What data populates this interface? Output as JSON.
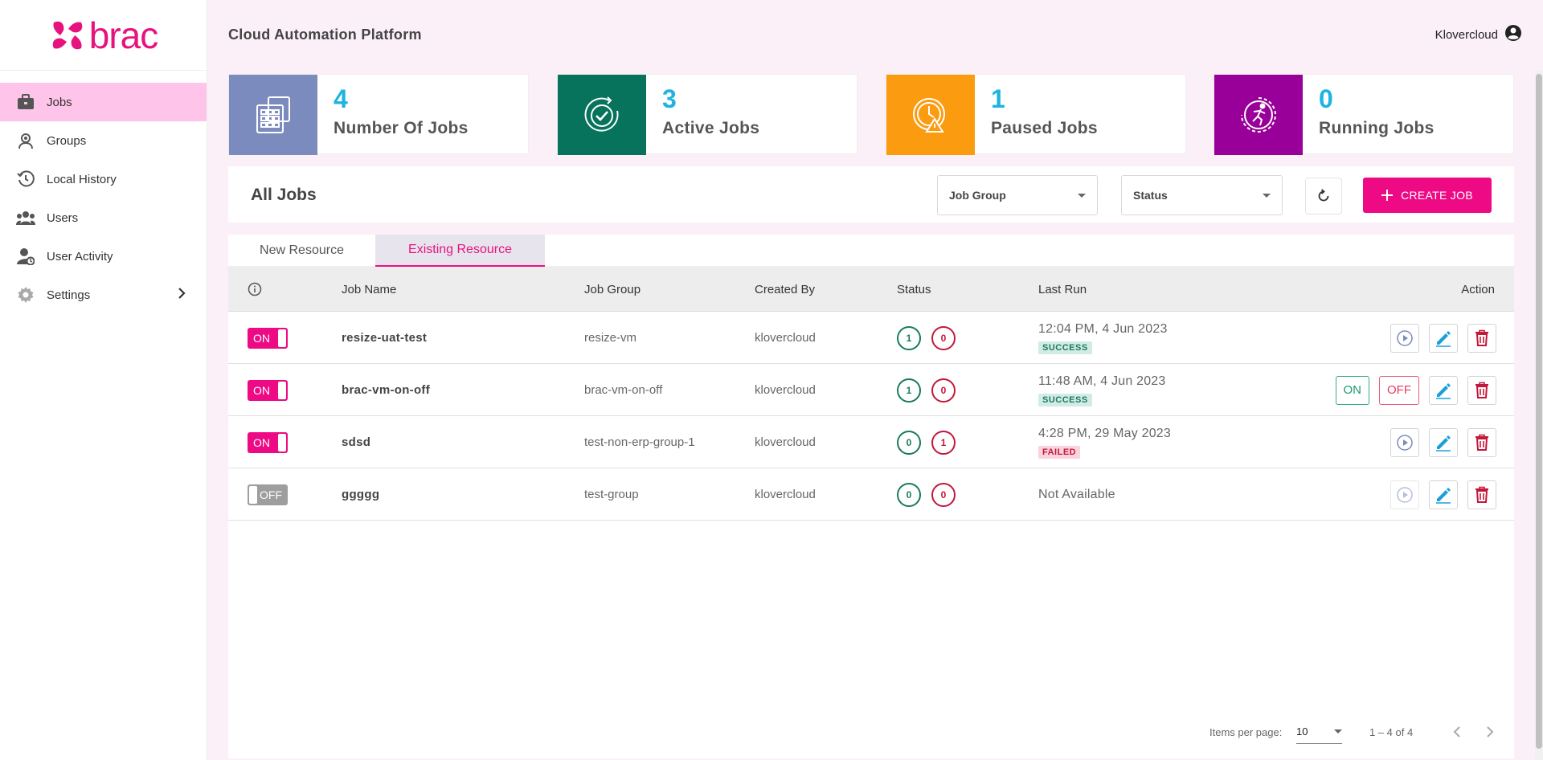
{
  "brand": {
    "logo_text": "brac",
    "color": "#e6137e"
  },
  "sidebar": {
    "items": [
      {
        "label": "Jobs",
        "icon": "briefcase-icon",
        "active": true
      },
      {
        "label": "Groups",
        "icon": "groups-icon",
        "active": false
      },
      {
        "label": "Local History",
        "icon": "history-icon",
        "active": false
      },
      {
        "label": "Users",
        "icon": "users-icon",
        "active": false
      },
      {
        "label": "User Activity",
        "icon": "user-activity-icon",
        "active": false
      },
      {
        "label": "Settings",
        "icon": "gear-icon",
        "active": false
      }
    ]
  },
  "header": {
    "title": "Cloud Automation Platform",
    "user": "Klovercloud"
  },
  "stats": [
    {
      "number": "4",
      "label": "Number Of Jobs",
      "color": "#7b8bbd",
      "icon": "calculator-icon"
    },
    {
      "number": "3",
      "label": "Active Jobs",
      "color": "#07735c",
      "icon": "check-circle-icon"
    },
    {
      "number": "1",
      "label": "Paused Jobs",
      "color": "#fb9b0f",
      "icon": "paused-clock-icon"
    },
    {
      "number": "0",
      "label": "Running Jobs",
      "color": "#990099",
      "icon": "runner-icon"
    }
  ],
  "jobs_bar": {
    "title": "All Jobs",
    "job_group_select": "Job Group",
    "status_select": "Status",
    "create_label": "CREATE JOB"
  },
  "tabs": [
    "New Resource",
    "Existing Resource"
  ],
  "table": {
    "headers": {
      "job_name": "Job Name",
      "job_group": "Job Group",
      "created_by": "Created By",
      "status": "Status",
      "last_run": "Last Run",
      "action": "Action"
    },
    "rows": [
      {
        "toggle": "ON",
        "name": "resize-uat-test",
        "group": "resize-vm",
        "created_by": "klovercloud",
        "ok": "1",
        "fail": "0",
        "last_run": "12:04 PM, 4 Jun 2023",
        "result": "SUCCESS"
      },
      {
        "toggle": "ON",
        "name": "brac-vm-on-off",
        "group": "brac-vm-on-off",
        "created_by": "klovercloud",
        "ok": "1",
        "fail": "0",
        "last_run": "11:48 AM, 4 Jun 2023",
        "result": "SUCCESS",
        "on_label": "ON",
        "off_label": "OFF"
      },
      {
        "toggle": "ON",
        "name": "sdsd",
        "group": "test-non-erp-group-1",
        "created_by": "klovercloud",
        "ok": "0",
        "fail": "1",
        "last_run": "4:28 PM, 29 May 2023",
        "result": "FAILED"
      },
      {
        "toggle": "OFF",
        "name": "ggggg",
        "group": "test-group",
        "created_by": "klovercloud",
        "ok": "0",
        "fail": "0",
        "last_run": "Not Available",
        "result": ""
      }
    ]
  },
  "pager": {
    "items_per_page_label": "Items per page:",
    "items_per_page": "10",
    "range": "1 – 4 of 4"
  }
}
